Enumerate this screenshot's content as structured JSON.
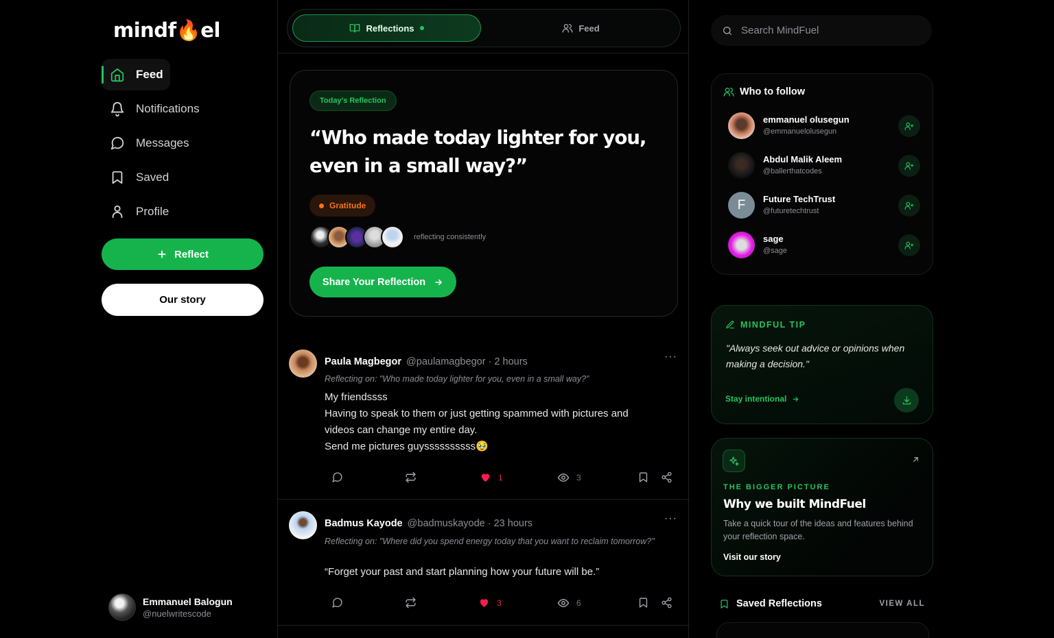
{
  "brand": {
    "logo_pre": "mindf",
    "logo_flame": "🔥",
    "logo_post": "el"
  },
  "sidebar": {
    "items": [
      {
        "label": "Feed",
        "icon": "home-icon",
        "active": true
      },
      {
        "label": "Notifications",
        "icon": "bell-icon"
      },
      {
        "label": "Messages",
        "icon": "message-icon"
      },
      {
        "label": "Saved",
        "icon": "bookmark-icon"
      },
      {
        "label": "Profile",
        "icon": "user-icon"
      }
    ],
    "reflect_label": "Reflect",
    "story_label": "Our story",
    "user": {
      "name": "Emmanuel Balogun",
      "handle": "@nuelwritescode"
    }
  },
  "tabs": [
    {
      "label": "Reflections"
    },
    {
      "label": "Feed"
    }
  ],
  "today": {
    "badge": "Today's Reflection",
    "question": "“Who made today lighter for you, even in a small way?”",
    "tag": "Gratitude",
    "consistency": "reflecting consistently",
    "cta": "Share Your Reflection"
  },
  "posts": [
    {
      "name": "Paula Magbegor",
      "handle": "@paulamagbegor",
      "time": "· 2 hours",
      "reflecting": "Reflecting on: \"Who made today lighter for you, even in a small way?\"",
      "lines": [
        "My friendssss",
        "Having to speak to them or just getting spammed with pictures and",
        "videos can change my entire day.",
        "Send me pictures guyssssssssss🥹"
      ],
      "likes": "1",
      "views": "3"
    },
    {
      "name": "Badmus Kayode",
      "handle": "@badmuskayode",
      "time": "· 23 hours",
      "reflecting": "Reflecting on: \"Where did you spend energy today that you want to reclaim tomorrow?\"",
      "lines": [
        "“Forget your past and start planning how your future will be.”"
      ],
      "likes": "3",
      "views": "6"
    }
  ],
  "search": {
    "placeholder": "Search MindFuel"
  },
  "who_to_follow": {
    "title": "Who to follow",
    "people": [
      {
        "name": "emmanuel olusegun",
        "handle": "@emmanuelolusegun"
      },
      {
        "name": "Abdul Malik Aleem",
        "handle": "@ballerthatcodes"
      },
      {
        "name": "Future TechTrust",
        "handle": "@futuretechtrust",
        "initial": "F"
      },
      {
        "name": "sage",
        "handle": "@sage"
      }
    ]
  },
  "tip": {
    "label": "MINDFUL TIP",
    "quote": "\"Always seek out advice or opinions when making a decision.\"",
    "link": "Stay intentional"
  },
  "bigger": {
    "eyebrow": "THE BIGGER PICTURE",
    "title": "Why we built MindFuel",
    "desc": "Take a quick tour of the ideas and features behind your reflection space.",
    "link": "Visit our story"
  },
  "saved": {
    "title": "Saved Reflections",
    "view_all": "VIEW ALL"
  },
  "colors": {
    "accent": "#16b34d",
    "tag": "#f97316",
    "like": "#f91d4d"
  }
}
